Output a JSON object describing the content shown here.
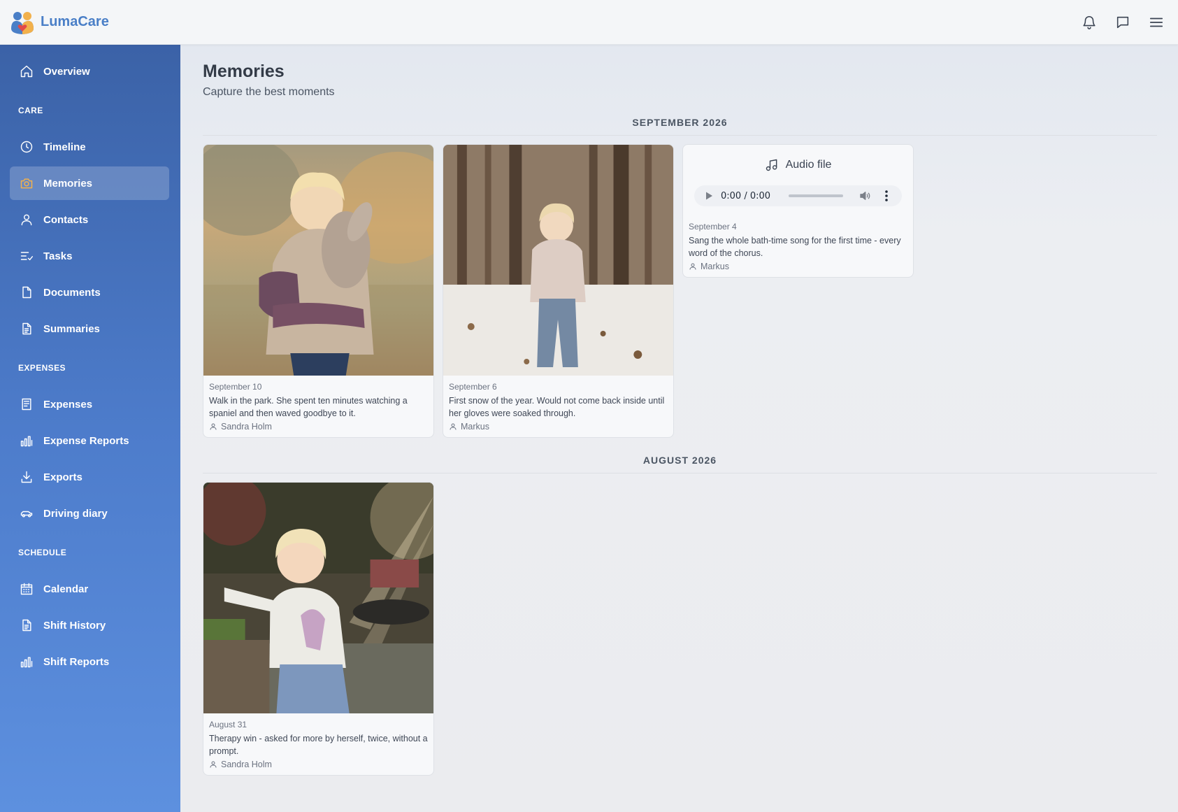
{
  "app": {
    "name": "LumaCare"
  },
  "header": {
    "actions": [
      {
        "name": "notifications",
        "icon": "bell-icon"
      },
      {
        "name": "messages",
        "icon": "chat-icon"
      },
      {
        "name": "menu",
        "icon": "hamburger-icon"
      }
    ]
  },
  "sidebar": {
    "overview": {
      "label": "Overview",
      "icon": "home-icon"
    },
    "sections": {
      "care": "CARE",
      "expenses": "EXPENSES",
      "schedule": "SCHEDULE"
    },
    "care_items": [
      {
        "label": "Timeline",
        "icon": "clock-icon"
      },
      {
        "label": "Memories",
        "icon": "camera-icon",
        "active": true
      },
      {
        "label": "Contacts",
        "icon": "user-icon"
      },
      {
        "label": "Tasks",
        "icon": "checklist-icon"
      },
      {
        "label": "Documents",
        "icon": "document-icon"
      },
      {
        "label": "Summaries",
        "icon": "document-text-icon"
      }
    ],
    "expense_items": [
      {
        "label": "Expenses",
        "icon": "receipt-icon"
      },
      {
        "label": "Expense Reports",
        "icon": "bar-chart-icon"
      },
      {
        "label": "Exports",
        "icon": "download-icon"
      },
      {
        "label": "Driving diary",
        "icon": "car-icon"
      }
    ],
    "schedule_items": [
      {
        "label": "Calendar",
        "icon": "calendar-icon"
      },
      {
        "label": "Shift History",
        "icon": "document-text-icon"
      },
      {
        "label": "Shift Reports",
        "icon": "bar-chart-icon"
      }
    ]
  },
  "page": {
    "title": "Memories",
    "subtitle": "Capture the best moments"
  },
  "months": [
    {
      "label": "SEPTEMBER 2026",
      "memories": [
        {
          "type": "photo",
          "date": "September 10",
          "text": "Walk in the park. She spent ten minutes watching a spaniel and then waved goodbye to it.",
          "author": "Sandra Holm"
        },
        {
          "type": "photo",
          "date": "September 6",
          "text": "First snow of the year. Would not come back inside until her gloves were soaked through.",
          "author": "Markus"
        },
        {
          "type": "audio",
          "audio_label": "Audio file",
          "audio_time": "0:00 / 0:00",
          "date": "September 4",
          "text": "Sang the whole bath-time song for the first time - every word of the chorus.",
          "author": "Markus"
        }
      ]
    },
    {
      "label": "AUGUST 2026",
      "memories": [
        {
          "type": "photo",
          "date": "August 31",
          "text": "Therapy win - asked for more by herself, twice, without a prompt.",
          "author": "Sandra Holm"
        }
      ]
    }
  ],
  "colors": {
    "brand": "#4a7fc7",
    "sidebar_top": "#3b62a7",
    "sidebar_bottom": "#5d90df",
    "active_icon": "#f2b14c"
  }
}
